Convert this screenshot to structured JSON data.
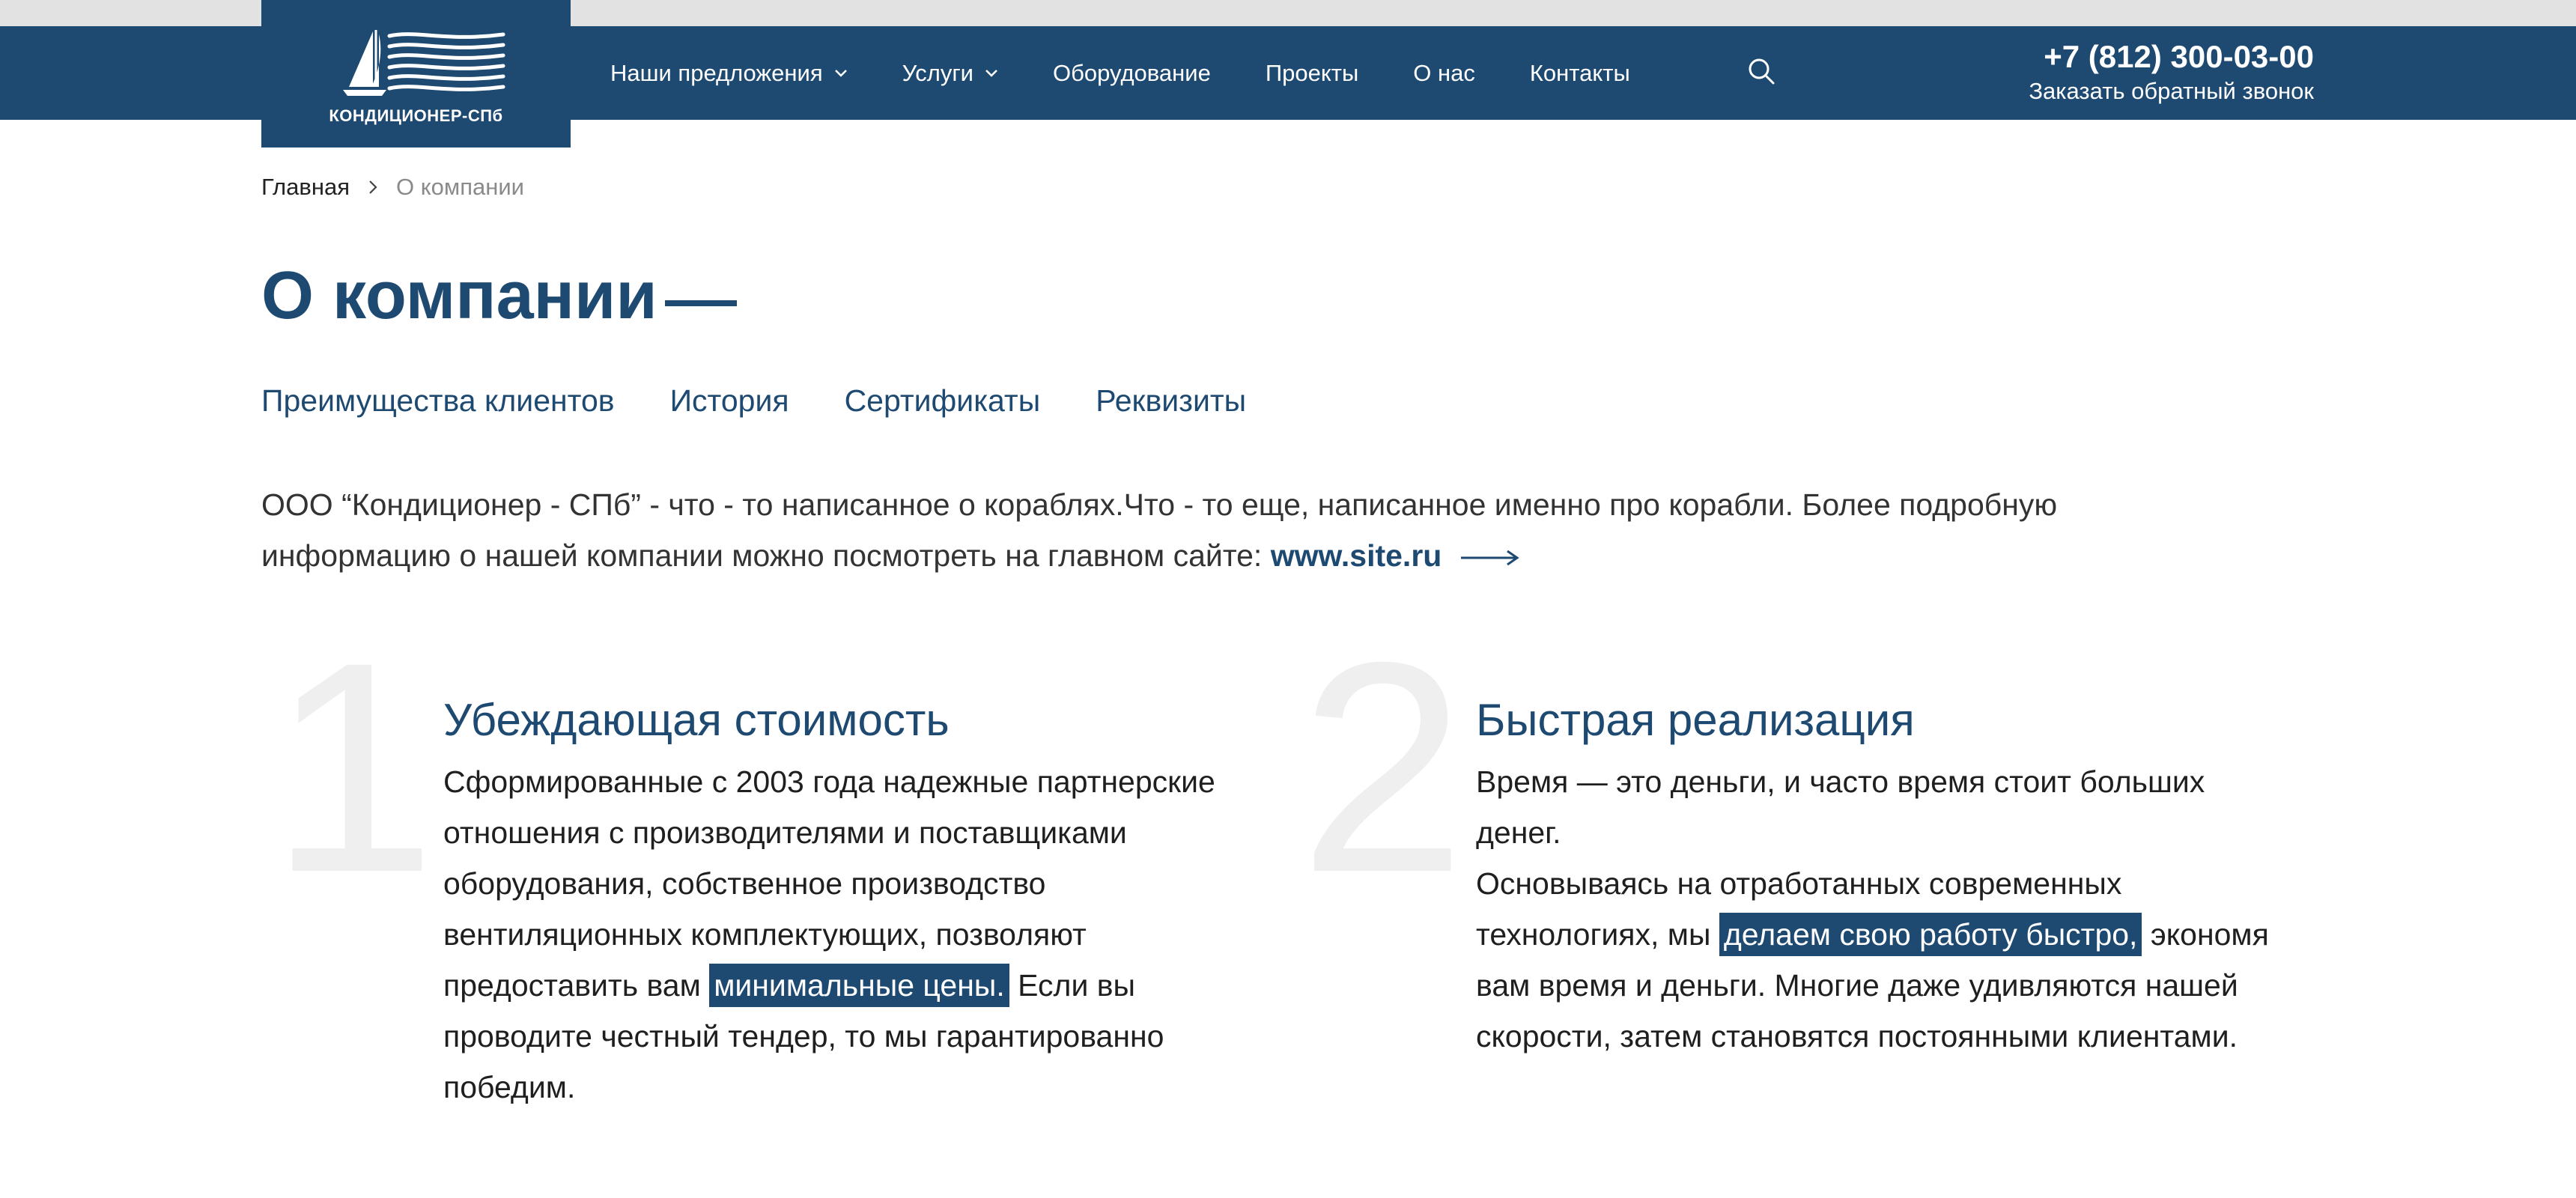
{
  "header": {
    "logo_text": "КОНДИЦИОНЕР-СПб",
    "menu": [
      {
        "label": "Наши предложения",
        "has_dropdown": true
      },
      {
        "label": "Услуги",
        "has_dropdown": true
      },
      {
        "label": "Оборудование",
        "has_dropdown": false
      },
      {
        "label": "Проекты",
        "has_dropdown": false
      },
      {
        "label": "О нас",
        "has_dropdown": false
      },
      {
        "label": "Контакты",
        "has_dropdown": false
      }
    ],
    "search_icon": "search-icon",
    "phone": "+7 (812) 300-03-00",
    "callback": "Заказать обратный звонок"
  },
  "breadcrumb": {
    "home": "Главная",
    "current": "О компании"
  },
  "page": {
    "title": "О компании"
  },
  "tabs": [
    "Преимущества клиентов",
    "История",
    "Сертификаты",
    "Реквизиты"
  ],
  "intro": {
    "text": "ООО “Кондиционер - СПб” - что - то написанное о кораблях.Что - то еще, написанное именно про корабли. Более подробную информацию о нашей компании можно посмотреть на главном сайте:",
    "link": "www.site.ru"
  },
  "features": [
    {
      "number": "1",
      "title": "Убеждающая стоимость",
      "text_before": "Сформированные с 2003 года надежные партнерские отношения с производителями и поставщиками оборудования, собственное производство вентиляционных комплектующих, позволяют предоставить вам",
      "highlight": "минимальные цены.",
      "text_after": "Если вы проводите честный тендер, то мы гарантированно победим."
    },
    {
      "number": "2",
      "title": "Быстрая реализация",
      "text_before": "Время — это деньги, и часто время стоит больших денег.",
      "text_before_2": "Основываясь на отработанных современных технологиях, мы",
      "highlight": "делаем свою работу быстро,",
      "text_after": "экономя вам время и деньги. Многие даже удивляются нашей скорости, затем становятся постоянными клиентами."
    }
  ],
  "colors": {
    "brand": "#1e4a72",
    "topstrip": "#e2e2e2",
    "big_number": "#efefef",
    "muted": "#8a8a8a"
  }
}
